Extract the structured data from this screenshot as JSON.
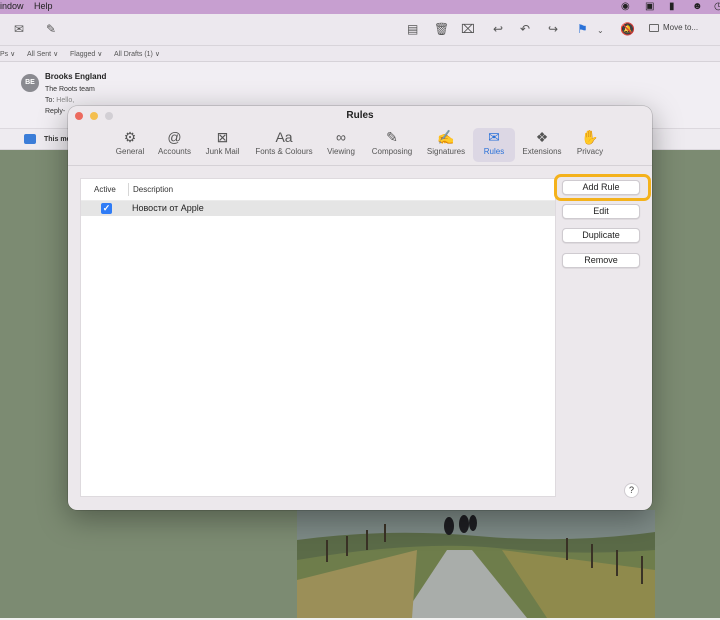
{
  "menubar": {
    "items": [
      "indow",
      "Help"
    ]
  },
  "toolbar": {
    "move_label": "Move to..."
  },
  "filters": [
    "Ps ∨",
    "All Sent ∨",
    "Flagged ∨",
    "All Drafts (1) ∨"
  ],
  "message": {
    "avatar_initials": "BE",
    "sender": "Brooks England",
    "subject": "The Roots team",
    "to_label": "To:",
    "to_value": "Hello,",
    "reply_label": "Reply-",
    "info_text": "This me"
  },
  "dialog": {
    "title": "Rules",
    "tabs": [
      {
        "label": "General",
        "icon": "gear-icon",
        "glyph": "⚙"
      },
      {
        "label": "Accounts",
        "icon": "at-icon",
        "glyph": "@"
      },
      {
        "label": "Junk Mail",
        "icon": "junk-tray-icon",
        "glyph": "⊠"
      },
      {
        "label": "Fonts & Colours",
        "icon": "fonts-icon",
        "glyph": "Aa"
      },
      {
        "label": "Viewing",
        "icon": "glasses-icon",
        "glyph": "∞"
      },
      {
        "label": "Composing",
        "icon": "compose-icon",
        "glyph": "✎"
      },
      {
        "label": "Signatures",
        "icon": "signature-icon",
        "glyph": "✍"
      },
      {
        "label": "Rules",
        "icon": "rules-envelope-icon",
        "glyph": "✉"
      },
      {
        "label": "Extensions",
        "icon": "puzzle-icon",
        "glyph": "❖"
      },
      {
        "label": "Privacy",
        "icon": "hand-icon",
        "glyph": "✋"
      }
    ],
    "active_tab": "Rules",
    "columns": {
      "active": "Active",
      "description": "Description"
    },
    "rules": [
      {
        "active": true,
        "description": "Новости от Apple"
      }
    ],
    "buttons": {
      "add": "Add Rule",
      "edit": "Edit",
      "duplicate": "Duplicate",
      "remove": "Remove"
    },
    "help": "?"
  },
  "colors": {
    "accent": "#2b72d8",
    "highlight": "#f4b21c",
    "menubar": "#c79fd0"
  }
}
